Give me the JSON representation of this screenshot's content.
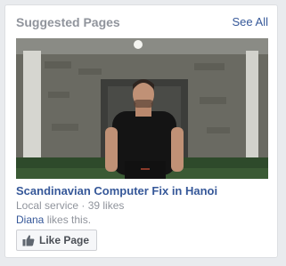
{
  "widget": {
    "title": "Suggested Pages",
    "see_all": "See All"
  },
  "page": {
    "name": "Scandinavian Computer Fix in Hanoi",
    "category_likes": "Local service · 39 likes",
    "friend_name": "Diana",
    "friend_suffix": " likes this.",
    "like_button": "Like Page"
  },
  "colors": {
    "link": "#365899",
    "muted": "#90949c",
    "background": "#e9ebee"
  },
  "icons": {
    "like": "thumbs-up-icon"
  }
}
